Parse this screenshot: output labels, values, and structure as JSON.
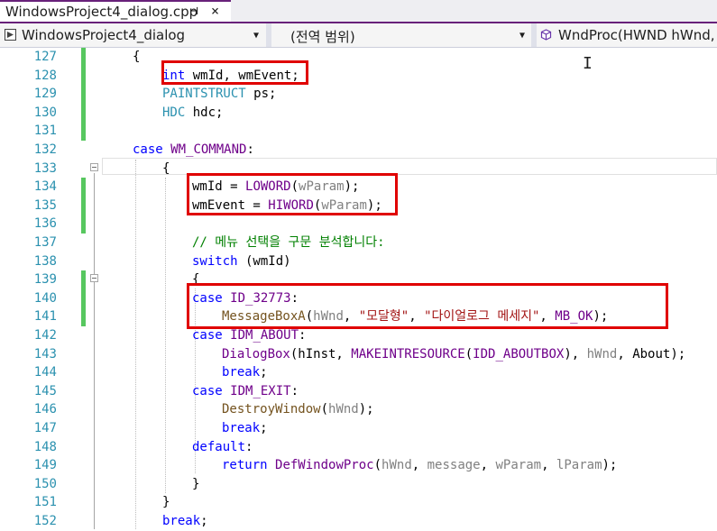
{
  "tab": {
    "title": "WindowsProject4_dialog.cpp",
    "pin": "⊣",
    "close": "×"
  },
  "navbar": {
    "project": "WindowsProject4_dialog",
    "scope": "(전역 범위)",
    "member": "WndProc(HWND hWnd, U"
  },
  "colors": {
    "keyword": "#0000ff",
    "type": "#2b91af",
    "macro": "#6f008a",
    "function": "#74531f",
    "param": "#808080",
    "string": "#a31515",
    "comment": "#008000",
    "highlight": "#e00000"
  },
  "icons": {
    "project": "cpp-project-icon",
    "member": "cube-icon",
    "fold": "collapse-icon"
  },
  "lines": [
    {
      "num": "127",
      "indent": 1,
      "tokens": [
        {
          "t": "{",
          "c": "pl"
        }
      ]
    },
    {
      "num": "128",
      "indent": 2,
      "tokens": [
        {
          "t": "int",
          "c": "kw"
        },
        {
          "t": " wmId, wmEvent;",
          "c": "pl"
        }
      ]
    },
    {
      "num": "129",
      "indent": 2,
      "tokens": [
        {
          "t": "PAINTSTRUCT",
          "c": "ty"
        },
        {
          "t": " ps;",
          "c": "pl"
        }
      ]
    },
    {
      "num": "130",
      "indent": 2,
      "tokens": [
        {
          "t": "HDC",
          "c": "ty"
        },
        {
          "t": " hdc;",
          "c": "pl"
        }
      ]
    },
    {
      "num": "131",
      "indent": 0,
      "tokens": []
    },
    {
      "num": "132",
      "indent": 1,
      "tokens": [
        {
          "t": "case",
          "c": "kw"
        },
        {
          "t": " ",
          "c": "pl"
        },
        {
          "t": "WM_COMMAND",
          "c": "mac"
        },
        {
          "t": ":",
          "c": "pl"
        }
      ]
    },
    {
      "num": "133",
      "indent": 2,
      "tokens": [
        {
          "t": "{",
          "c": "pl"
        }
      ]
    },
    {
      "num": "134",
      "indent": 3,
      "tokens": [
        {
          "t": "wmId = ",
          "c": "pl"
        },
        {
          "t": "LOWORD",
          "c": "mac"
        },
        {
          "t": "(",
          "c": "pl"
        },
        {
          "t": "wParam",
          "c": "par"
        },
        {
          "t": ");",
          "c": "pl"
        }
      ]
    },
    {
      "num": "135",
      "indent": 3,
      "tokens": [
        {
          "t": "wmEvent = ",
          "c": "pl"
        },
        {
          "t": "HIWORD",
          "c": "mac"
        },
        {
          "t": "(",
          "c": "pl"
        },
        {
          "t": "wParam",
          "c": "par"
        },
        {
          "t": ");",
          "c": "pl"
        }
      ]
    },
    {
      "num": "136",
      "indent": 0,
      "tokens": []
    },
    {
      "num": "137",
      "indent": 3,
      "tokens": [
        {
          "t": "// 메뉴 선택을 구문 분석합니다:",
          "c": "cm"
        }
      ]
    },
    {
      "num": "138",
      "indent": 3,
      "tokens": [
        {
          "t": "switch",
          "c": "kw"
        },
        {
          "t": " (wmId)",
          "c": "pl"
        }
      ]
    },
    {
      "num": "139",
      "indent": 3,
      "tokens": [
        {
          "t": "{",
          "c": "pl"
        }
      ]
    },
    {
      "num": "140",
      "indent": 3,
      "tokens": [
        {
          "t": "case",
          "c": "kw"
        },
        {
          "t": " ",
          "c": "pl"
        },
        {
          "t": "ID_32773",
          "c": "mac"
        },
        {
          "t": ":",
          "c": "pl"
        }
      ]
    },
    {
      "num": "141",
      "indent": 4,
      "tokens": [
        {
          "t": "MessageBoxA",
          "c": "fn"
        },
        {
          "t": "(",
          "c": "pl"
        },
        {
          "t": "hWnd",
          "c": "par"
        },
        {
          "t": ", ",
          "c": "pl"
        },
        {
          "t": "\"모달형\"",
          "c": "str"
        },
        {
          "t": ", ",
          "c": "pl"
        },
        {
          "t": "\"다이얼로그 메세지\"",
          "c": "str"
        },
        {
          "t": ", ",
          "c": "pl"
        },
        {
          "t": "MB_OK",
          "c": "mac"
        },
        {
          "t": ");",
          "c": "pl"
        }
      ]
    },
    {
      "num": "142",
      "indent": 3,
      "tokens": [
        {
          "t": "case",
          "c": "kw"
        },
        {
          "t": " ",
          "c": "pl"
        },
        {
          "t": "IDM_ABOUT",
          "c": "mac"
        },
        {
          "t": ":",
          "c": "pl"
        }
      ]
    },
    {
      "num": "143",
      "indent": 4,
      "tokens": [
        {
          "t": "DialogBox",
          "c": "mac"
        },
        {
          "t": "(hInst, ",
          "c": "pl"
        },
        {
          "t": "MAKEINTRESOURCE",
          "c": "mac"
        },
        {
          "t": "(",
          "c": "pl"
        },
        {
          "t": "IDD_ABOUTBOX",
          "c": "mac"
        },
        {
          "t": "), ",
          "c": "pl"
        },
        {
          "t": "hWnd",
          "c": "par"
        },
        {
          "t": ", About);",
          "c": "pl"
        }
      ]
    },
    {
      "num": "144",
      "indent": 4,
      "tokens": [
        {
          "t": "break",
          "c": "kw"
        },
        {
          "t": ";",
          "c": "pl"
        }
      ]
    },
    {
      "num": "145",
      "indent": 3,
      "tokens": [
        {
          "t": "case",
          "c": "kw"
        },
        {
          "t": " ",
          "c": "pl"
        },
        {
          "t": "IDM_EXIT",
          "c": "mac"
        },
        {
          "t": ":",
          "c": "pl"
        }
      ]
    },
    {
      "num": "146",
      "indent": 4,
      "tokens": [
        {
          "t": "DestroyWindow",
          "c": "fn"
        },
        {
          "t": "(",
          "c": "pl"
        },
        {
          "t": "hWnd",
          "c": "par"
        },
        {
          "t": ");",
          "c": "pl"
        }
      ]
    },
    {
      "num": "147",
      "indent": 4,
      "tokens": [
        {
          "t": "break",
          "c": "kw"
        },
        {
          "t": ";",
          "c": "pl"
        }
      ]
    },
    {
      "num": "148",
      "indent": 3,
      "tokens": [
        {
          "t": "default",
          "c": "kw"
        },
        {
          "t": ":",
          "c": "pl"
        }
      ]
    },
    {
      "num": "149",
      "indent": 4,
      "tokens": [
        {
          "t": "return",
          "c": "kw"
        },
        {
          "t": " ",
          "c": "pl"
        },
        {
          "t": "DefWindowProc",
          "c": "mac"
        },
        {
          "t": "(",
          "c": "pl"
        },
        {
          "t": "hWnd",
          "c": "par"
        },
        {
          "t": ", ",
          "c": "pl"
        },
        {
          "t": "message",
          "c": "par"
        },
        {
          "t": ", ",
          "c": "pl"
        },
        {
          "t": "wParam",
          "c": "par"
        },
        {
          "t": ", ",
          "c": "pl"
        },
        {
          "t": "lParam",
          "c": "par"
        },
        {
          "t": ");",
          "c": "pl"
        }
      ]
    },
    {
      "num": "150",
      "indent": 3,
      "tokens": [
        {
          "t": "}",
          "c": "pl"
        }
      ]
    },
    {
      "num": "151",
      "indent": 2,
      "tokens": [
        {
          "t": "}",
          "c": "pl"
        }
      ]
    },
    {
      "num": "152",
      "indent": 2,
      "tokens": [
        {
          "t": "break",
          "c": "kw"
        },
        {
          "t": ";",
          "c": "pl"
        }
      ]
    }
  ]
}
